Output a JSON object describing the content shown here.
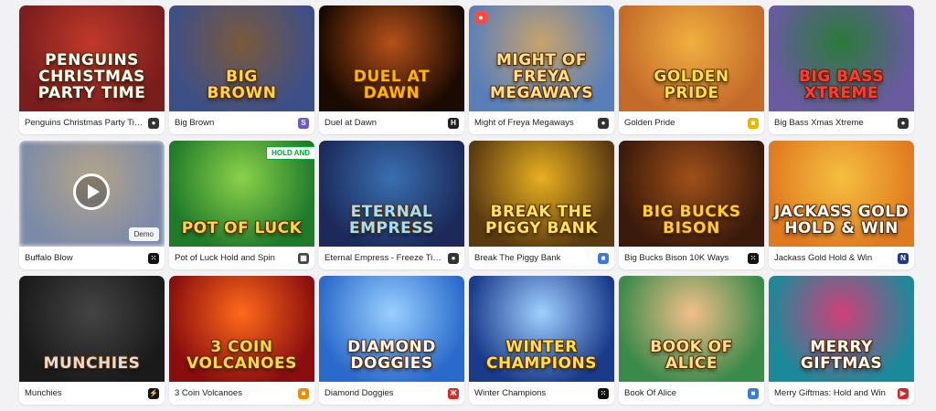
{
  "games": [
    {
      "title": "Penguins Christmas Party Time",
      "logo": "PENGUINS\nCHRISTMAS\nPARTY TIME",
      "bg": [
        "#7a1d1d",
        "#c0392b"
      ],
      "logo_color": "#ffffff",
      "provider_icon": "provider-dark-icon",
      "provider_color": "#333333",
      "provider_glyph": "●"
    },
    {
      "title": "Big Brown",
      "logo": "BIG\nBROWN",
      "bg": [
        "#3d4f88",
        "#7a5a3a"
      ],
      "logo_color": "#ffd54a",
      "provider_icon": "provider-swirl-icon",
      "provider_color": "#6a5acd",
      "provider_glyph": "S"
    },
    {
      "title": "Duel at Dawn",
      "logo": "DUEL AT DAWN",
      "bg": [
        "#1a0a00",
        "#b5501a"
      ],
      "logo_color": "#ffb400",
      "provider_icon": "provider-h-icon",
      "provider_color": "#222222",
      "provider_glyph": "H"
    },
    {
      "title": "Might of Freya Megaways",
      "logo": "MIGHT OF FREYA\nMEGAWAYS",
      "bg": [
        "#5a7fb8",
        "#c8a36a"
      ],
      "logo_color": "#ffe08a",
      "provider_icon": "provider-dark-icon",
      "provider_color": "#333333",
      "provider_glyph": "●",
      "corner_badge": true
    },
    {
      "title": "Golden Pride",
      "logo": "GOLDEN\nPRIDE",
      "bg": [
        "#c46a2a",
        "#f0b040"
      ],
      "logo_color": "#ffe14a",
      "provider_icon": "provider-gold-icon",
      "provider_color": "#e6b800",
      "provider_glyph": "■"
    },
    {
      "title": "Big Bass Xmas Xtreme",
      "logo": "BIG BASS\nXTREME",
      "bg": [
        "#6a5aa0",
        "#2a7a3a"
      ],
      "logo_color": "#ff3a3a",
      "provider_icon": "provider-dark-icon",
      "provider_color": "#333333",
      "provider_glyph": "●"
    },
    {
      "title": "Buffalo Blow",
      "logo": "",
      "bg": [
        "#7c8aa8",
        "#b3a48a"
      ],
      "logo_color": "#ffffff",
      "provider_icon": "provider-dots-icon",
      "provider_color": "#111111",
      "provider_glyph": "⁙",
      "demo_label": "Demo",
      "playable": true
    },
    {
      "title": "Pot of Luck Hold and Spin",
      "logo": "POT OF LUCK",
      "bg": [
        "#1f7a2a",
        "#8bd14a"
      ],
      "logo_color": "#ffd54a",
      "provider_icon": "provider-grid-icon",
      "provider_color": "#444444",
      "provider_glyph": "▦",
      "hold_tag": "HOLD AND"
    },
    {
      "title": "Eternal Empress - Freeze Time",
      "logo": "ETERNAL\nEMPRESS",
      "bg": [
        "#1b2a5a",
        "#3a6fb0"
      ],
      "logo_color": "#9ee0ff",
      "provider_icon": "provider-dark-icon",
      "provider_color": "#333333",
      "provider_glyph": "●"
    },
    {
      "title": "Break The Piggy Bank",
      "logo": "BREAK THE\nPIGGY BANK",
      "bg": [
        "#5a3a10",
        "#e8b020"
      ],
      "logo_color": "#ffe55a",
      "provider_icon": "provider-blue-icon",
      "provider_color": "#3a7bd5",
      "provider_glyph": "■"
    },
    {
      "title": "Big Bucks Bison 10K Ways",
      "logo": "BIG BUCKS\nBISON",
      "bg": [
        "#3a1a0a",
        "#a0501a"
      ],
      "logo_color": "#ffcc33",
      "provider_icon": "provider-dots-icon",
      "provider_color": "#111111",
      "provider_glyph": "⁙"
    },
    {
      "title": "Jackass Gold Hold & Win",
      "logo": "JACKASS GOLD\nHOLD & WIN",
      "bg": [
        "#e07a20",
        "#f5c040"
      ],
      "logo_color": "#ffffff",
      "provider_icon": "provider-n-icon",
      "provider_color": "#1e3a8a",
      "provider_glyph": "N"
    },
    {
      "title": "Munchies",
      "logo": "MUNCHIES",
      "bg": [
        "#1a1a1a",
        "#444444"
      ],
      "logo_color": "#dddddd",
      "provider_icon": "provider-bolt-icon",
      "provider_color": "#111111",
      "provider_glyph": "⚡"
    },
    {
      "title": "3 Coin Volcanoes",
      "logo": "3 COIN\nVOLCANOES",
      "bg": [
        "#8a0e0e",
        "#ff6a1a"
      ],
      "logo_color": "#ffd54a",
      "provider_icon": "provider-orange-icon",
      "provider_color": "#f08c00",
      "provider_glyph": "■"
    },
    {
      "title": "Diamond Doggies",
      "logo": "DIAMOND\nDOGGIES",
      "bg": [
        "#2a6acb",
        "#9ad0ff"
      ],
      "logo_color": "#ffffff",
      "provider_icon": "provider-red-icon",
      "provider_color": "#d62828",
      "provider_glyph": "Ж"
    },
    {
      "title": "Winter Champions",
      "logo": "WINTER\nCHAMPIONS",
      "bg": [
        "#1a3a8a",
        "#9fd0ff"
      ],
      "logo_color": "#ffe14a",
      "provider_icon": "provider-dots-icon",
      "provider_color": "#111111",
      "provider_glyph": "⁙"
    },
    {
      "title": "Book Of Alice",
      "logo": "BOOK OF ALICE",
      "bg": [
        "#3a8a4a",
        "#f2c08a"
      ],
      "logo_color": "#ffe08a",
      "provider_icon": "provider-blue-icon",
      "provider_color": "#3a7bd5",
      "provider_glyph": "■"
    },
    {
      "title": "Merry Giftmas: Hold and Win",
      "logo": "MERRY\nGIFTMAS",
      "bg": [
        "#1a8a9a",
        "#d0407a"
      ],
      "logo_color": "#ffffff",
      "provider_icon": "provider-play-icon",
      "provider_color": "#d62828",
      "provider_glyph": "▶"
    }
  ]
}
